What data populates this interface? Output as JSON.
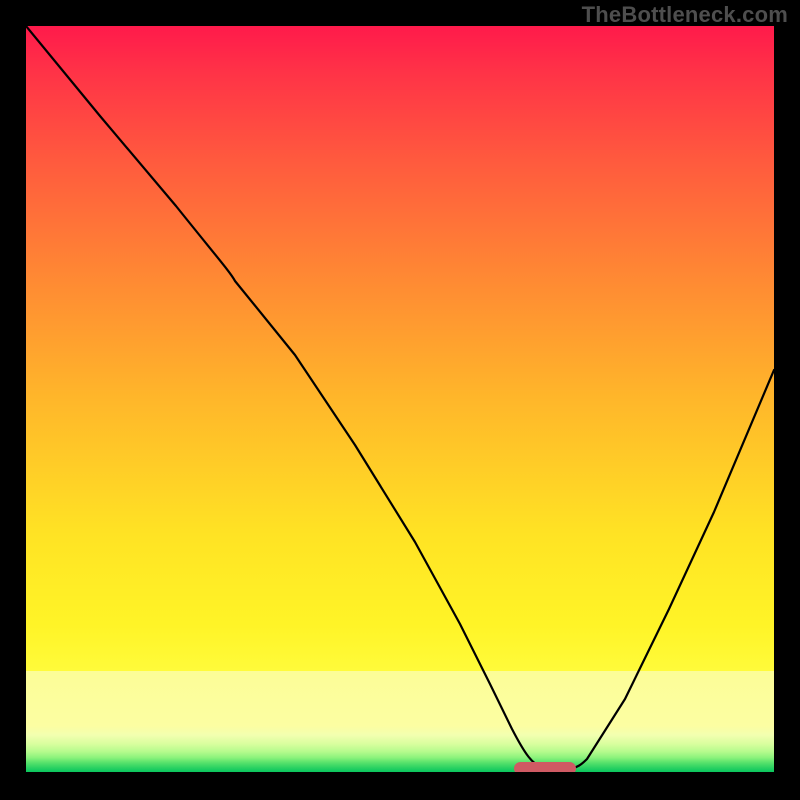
{
  "watermark": "TheBottleneck.com",
  "chart_data": {
    "type": "line",
    "title": "",
    "xlabel": "",
    "ylabel": "",
    "xlim": [
      0,
      100
    ],
    "ylim": [
      0,
      100
    ],
    "grid": false,
    "legend": false,
    "series": [
      {
        "name": "bottleneck-curve",
        "x": [
          0,
          10,
          20,
          28,
          36,
          44,
          52,
          58,
          62,
          65,
          68,
          72,
          75,
          80,
          86,
          92,
          100
        ],
        "values": [
          100,
          88,
          76,
          67,
          56,
          44,
          31,
          20,
          12,
          6,
          2,
          0,
          2,
          10,
          22,
          35,
          54
        ],
        "note": "Approximate trace read from pixels; single V-shaped curve with knee near x≈28 on the descending arm and minimum near x≈70."
      }
    ],
    "annotations": [
      {
        "name": "optimal-marker",
        "shape": "rounded-bar",
        "x_center": 69,
        "y_center": 0.8,
        "width_x": 8,
        "color": "#cf5a63",
        "note": "Small pink pill at curve minimum, sitting just above green baseline."
      }
    ],
    "background": {
      "type": "vertical-gradient",
      "stops": [
        {
          "pos": 0.0,
          "color": "#ff1a4b"
        },
        {
          "pos": 0.5,
          "color": "#ffb72a"
        },
        {
          "pos": 0.86,
          "color": "#fffb3a"
        },
        {
          "pos": 0.95,
          "color": "#e7ffab"
        },
        {
          "pos": 1.0,
          "color": "#05c45d"
        }
      ]
    }
  }
}
